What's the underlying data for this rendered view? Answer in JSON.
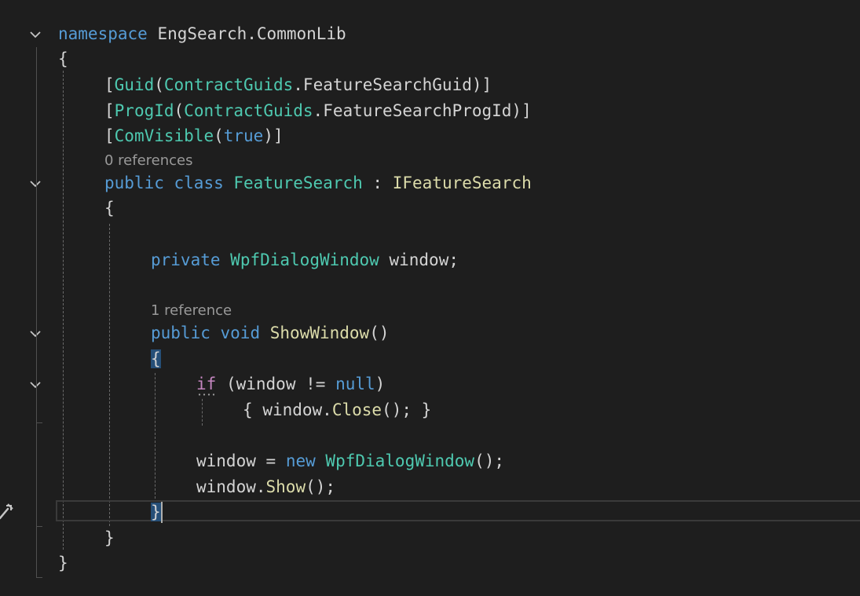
{
  "editor": {
    "codelens": {
      "class_refs": "0 references",
      "method_refs": "1 reference"
    },
    "tokens": {
      "namespace_kw": "namespace",
      "namespace_name": "EngSearch",
      "dot": ".",
      "namespace_sub": "CommonLib",
      "open_brace": "{",
      "close_brace": "}",
      "lbracket": "[",
      "rbracket": "]",
      "lparen": "(",
      "rparen": ")",
      "guid_attr": "Guid",
      "progid_attr": "ProgId",
      "comvisible_attr": "ComVisible",
      "contract_guids": "ContractGuids",
      "feature_search_guid": "FeatureSearchGuid",
      "feature_search_progid": "FeatureSearchProgId",
      "true_kw": "true",
      "public_kw": "public",
      "class_kw": "class",
      "class_name": "FeatureSearch",
      "colon": ":",
      "interface_name": "IFeatureSearch",
      "private_kw": "private",
      "wpf_dialog_window": "WpfDialogWindow",
      "window_field": "window",
      "semicolon": ";",
      "void_kw": "void",
      "show_window_method": "ShowWindow",
      "parens": "()",
      "if_kw": "if",
      "neq": "!=",
      "null_kw": "null",
      "close_method": "Close",
      "assign": "=",
      "new_kw": "new",
      "show_method": "Show"
    }
  },
  "colors": {
    "background": "#1e1e1e",
    "keyword": "#569cd6",
    "control_keyword": "#c586c0",
    "type": "#4ec9b0",
    "function": "#dcdcaa",
    "text": "#d4d4d4",
    "codelens": "#999999",
    "bracket_highlight": "#264f78"
  },
  "icons": {
    "fold_chevron": "chevron-down-icon",
    "lightbulb": "lightbulb-icon"
  }
}
